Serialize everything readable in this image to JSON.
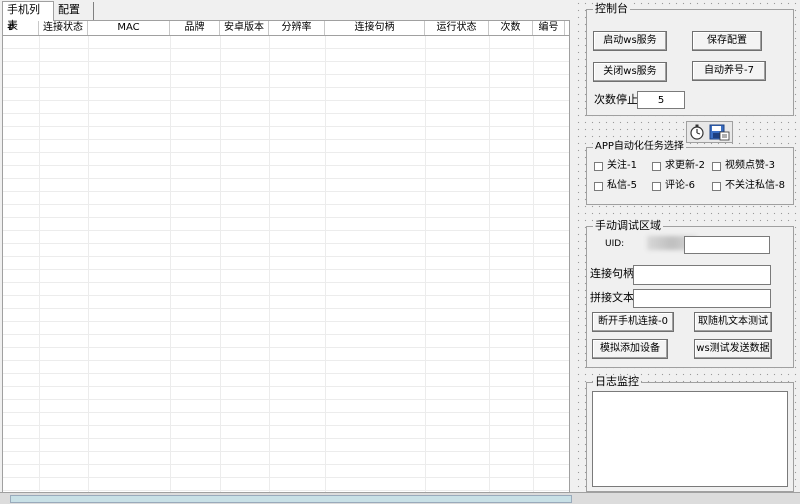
{
  "tabs": [
    {
      "label": "手机列表",
      "active": true
    },
    {
      "label": "配置",
      "active": false
    }
  ],
  "table": {
    "columns": [
      "#",
      "连接状态",
      "MAC",
      "品牌",
      "安卓版本",
      "分辨率",
      "连接句柄",
      "运行状态",
      "次数",
      "编号"
    ],
    "rows": []
  },
  "control": {
    "title": "控制台",
    "start_ws_label": "启动ws服务",
    "save_config_label": "保存配置",
    "stop_ws_label": "关闭ws服务",
    "auto_account_label": "自动养号-7",
    "count_stop_label": "次数停止",
    "count_stop_value": "5"
  },
  "tasks": {
    "title": "APP自动化任务选择",
    "options": [
      {
        "label": "关注-1",
        "checked": false
      },
      {
        "label": "求更新-2",
        "checked": false
      },
      {
        "label": "视频点赞-3",
        "checked": false
      },
      {
        "label": "私信-5",
        "checked": false
      },
      {
        "label": "评论-6",
        "checked": false
      },
      {
        "label": "不关注私信-8",
        "checked": false
      }
    ]
  },
  "manual": {
    "title": "手动调试区域",
    "uid_label": "UID:",
    "uid_value": "",
    "handle_label": "连接句柄",
    "handle_value": "",
    "text_label": "拼接文本",
    "text_value": "",
    "disconnect_label": "断开手机连接-0",
    "random_text_label": "取随机文本测试",
    "add_device_label": "模拟添加设备",
    "ws_send_label": "ws测试发送数据"
  },
  "log": {
    "title": "日志监控",
    "content": ""
  },
  "colors": {
    "background": "#f0f0f0",
    "border": "#a0a0a0",
    "input_bg": "#ffffff"
  }
}
